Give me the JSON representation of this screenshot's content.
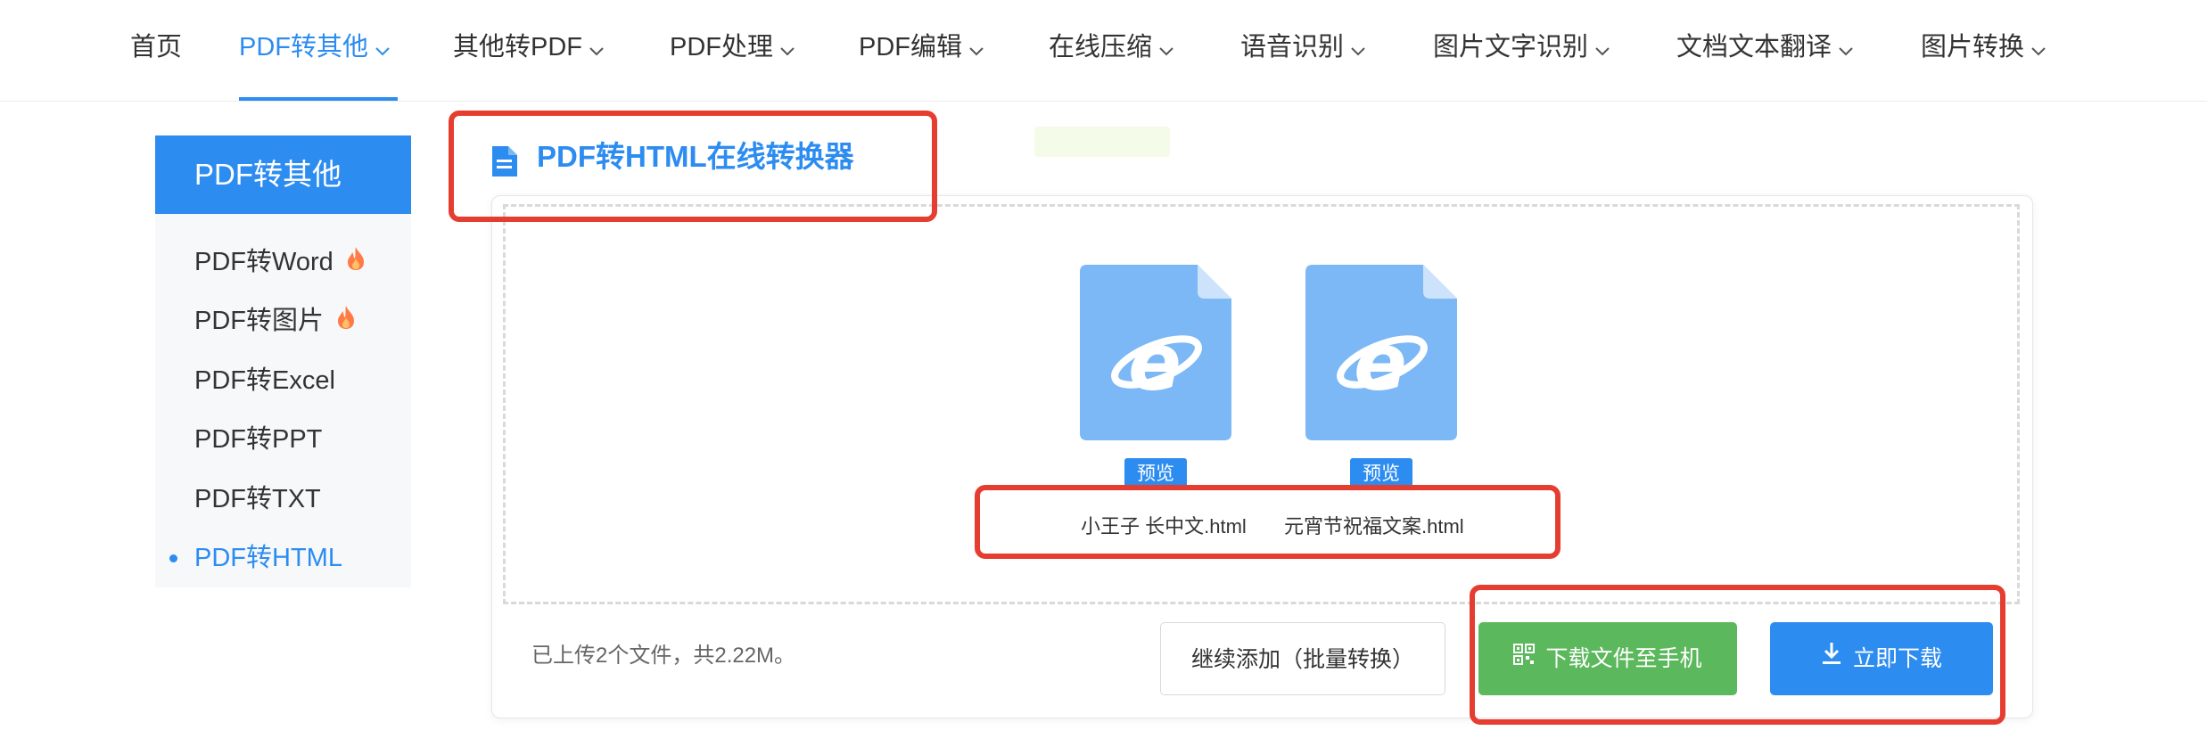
{
  "nav": {
    "items": [
      {
        "label": "首页",
        "has_dropdown": false
      },
      {
        "label": "PDF转其他",
        "has_dropdown": true,
        "active": true
      },
      {
        "label": "其他转PDF",
        "has_dropdown": true
      },
      {
        "label": "PDF处理",
        "has_dropdown": true
      },
      {
        "label": "PDF编辑",
        "has_dropdown": true
      },
      {
        "label": "在线压缩",
        "has_dropdown": true
      },
      {
        "label": "语音识别",
        "has_dropdown": true
      },
      {
        "label": "图片文字识别",
        "has_dropdown": true
      },
      {
        "label": "文档文本翻译",
        "has_dropdown": true
      },
      {
        "label": "图片转换",
        "has_dropdown": true
      }
    ]
  },
  "sidebar": {
    "title": "PDF转其他",
    "items": [
      {
        "label": "PDF转Word",
        "hot": true
      },
      {
        "label": "PDF转图片",
        "hot": true
      },
      {
        "label": "PDF转Excel",
        "hot": false
      },
      {
        "label": "PDF转PPT",
        "hot": false
      },
      {
        "label": "PDF转TXT",
        "hot": false
      },
      {
        "label": "PDF转HTML",
        "hot": false,
        "active": true
      }
    ]
  },
  "main": {
    "title": "PDF转HTML在线转换器",
    "files": [
      {
        "name": "小王子 长中文.html",
        "icon": "ie-file-icon",
        "preview_label": "预览"
      },
      {
        "name": "元宵节祝福文案.html",
        "icon": "ie-file-icon",
        "preview_label": "预览"
      }
    ],
    "upload_info": "已上传2个文件，共2.22M。",
    "continue_button": "继续添加（批量转换）",
    "phone_button": "下载文件至手机",
    "download_button": "立即下载"
  },
  "colors": {
    "accent": "#2d8cf0",
    "green": "#5cb85c",
    "annotation_red": "#e53d2f",
    "file_icon": "#7bb8f5"
  }
}
